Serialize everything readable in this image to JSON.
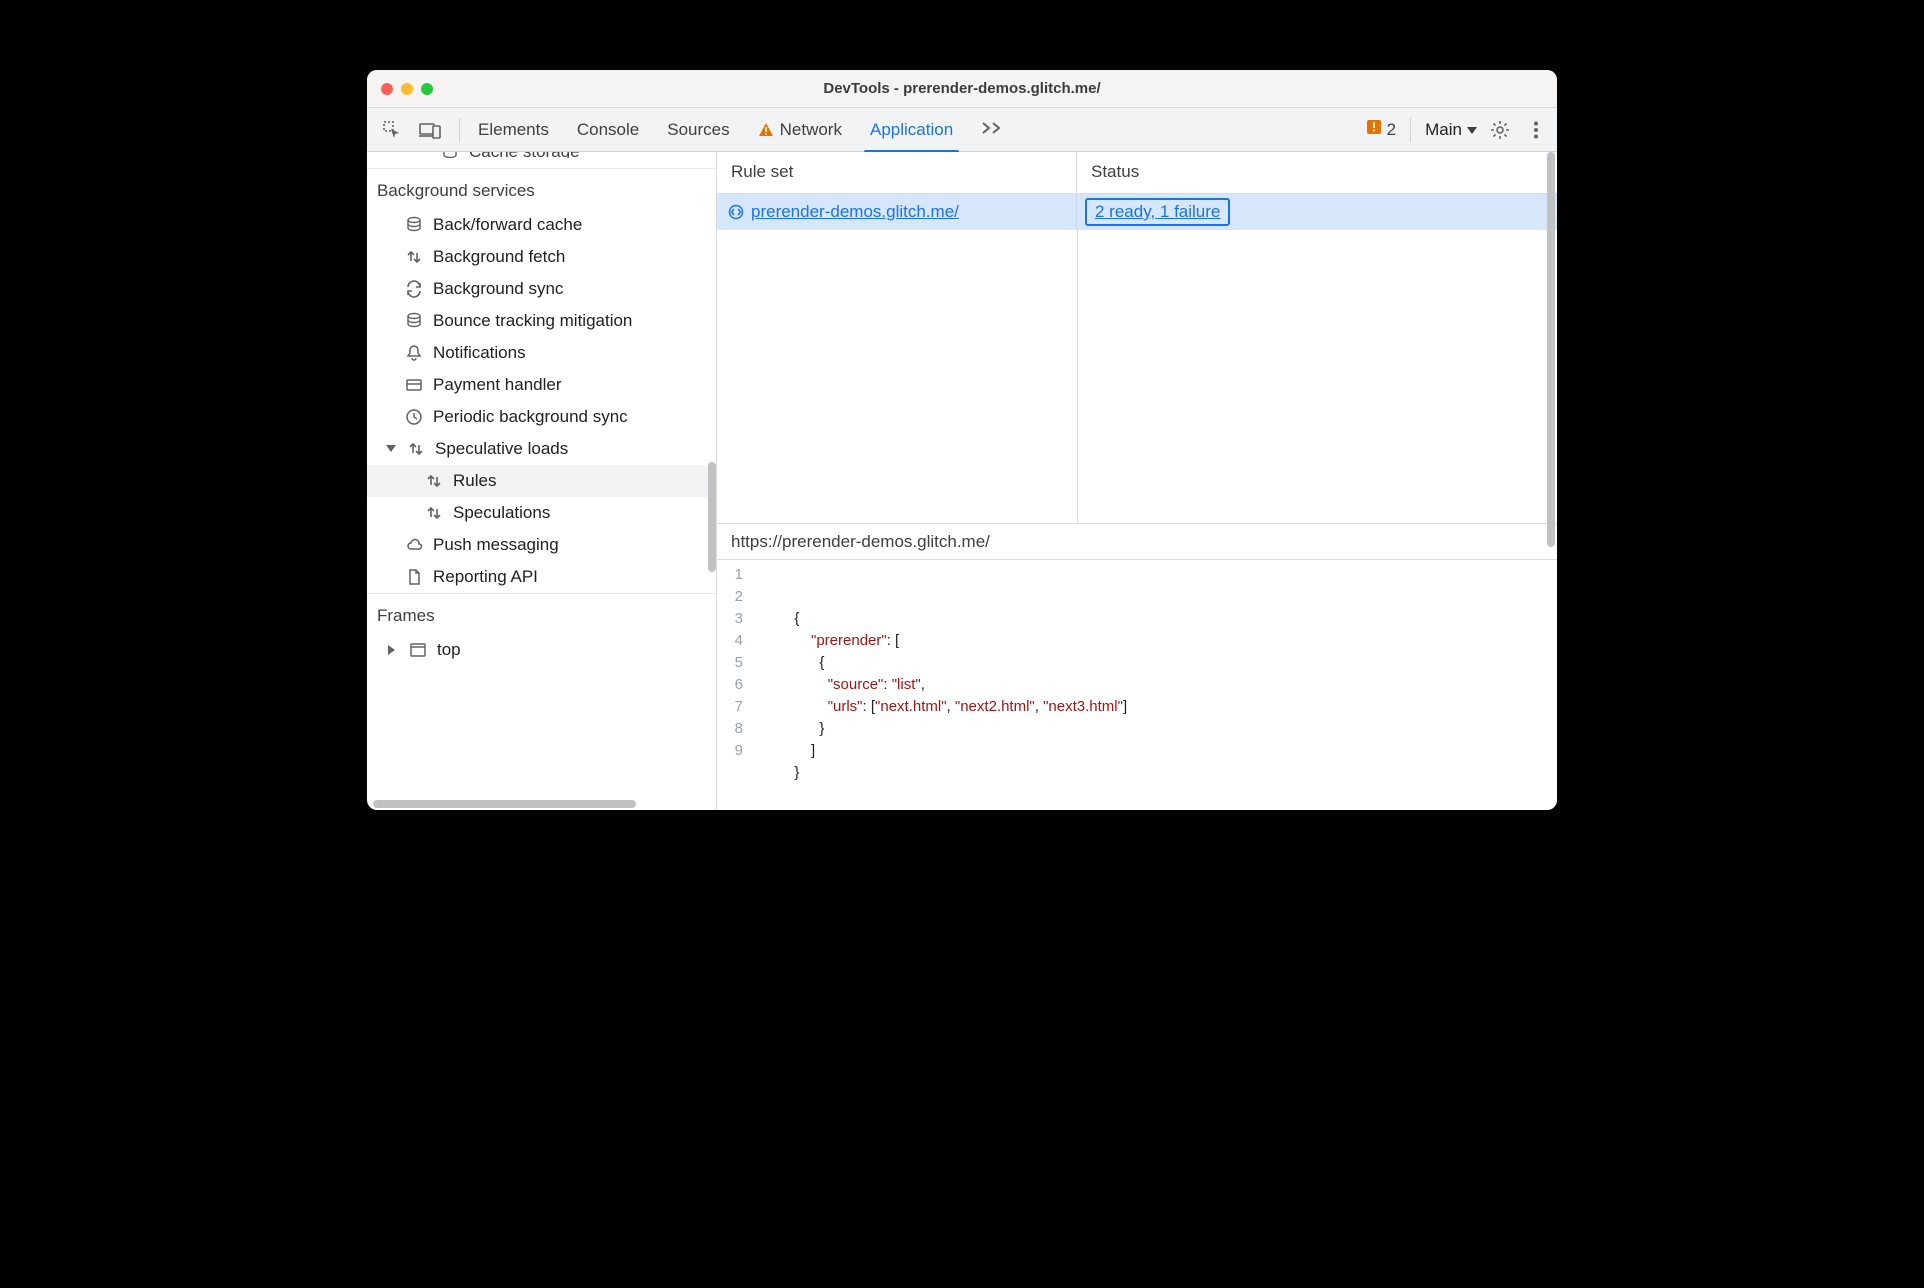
{
  "titlebar": {
    "title": "DevTools - prerender-demos.glitch.me/"
  },
  "tabs": {
    "elements": "Elements",
    "console": "Console",
    "sources": "Sources",
    "network": "Network",
    "application": "Application"
  },
  "toolbar": {
    "issues_count": "2",
    "context_label": "Main"
  },
  "sidebar": {
    "truncated_top": "Cache storage",
    "bg_services_header": "Background services",
    "items": [
      {
        "name": "back-forward-cache",
        "label": "Back/forward cache",
        "icon": "db"
      },
      {
        "name": "background-fetch",
        "label": "Background fetch",
        "icon": "updown"
      },
      {
        "name": "background-sync",
        "label": "Background sync",
        "icon": "sync"
      },
      {
        "name": "bounce-tracking",
        "label": "Bounce tracking mitigation",
        "icon": "db"
      },
      {
        "name": "notifications",
        "label": "Notifications",
        "icon": "bell"
      },
      {
        "name": "payment-handler",
        "label": "Payment handler",
        "icon": "card"
      },
      {
        "name": "periodic-bg-sync",
        "label": "Periodic background sync",
        "icon": "clock"
      },
      {
        "name": "speculative-loads",
        "label": "Speculative loads",
        "icon": "updown",
        "expandable": true,
        "expanded": true,
        "children": [
          {
            "name": "rules",
            "label": "Rules",
            "icon": "updown",
            "selected": true
          },
          {
            "name": "speculations",
            "label": "Speculations",
            "icon": "updown"
          }
        ]
      },
      {
        "name": "push-messaging",
        "label": "Push messaging",
        "icon": "cloud"
      },
      {
        "name": "reporting-api",
        "label": "Reporting API",
        "icon": "doc"
      }
    ],
    "frames_header": "Frames",
    "frames_top": "top"
  },
  "table": {
    "head_ruleset": "Rule set",
    "head_status": "Status",
    "row": {
      "ruleset_label": " prerender-demos.glitch.me/",
      "status_label": "2 ready, 1 failure"
    }
  },
  "code_panel": {
    "header": "https://prerender-demos.glitch.me/",
    "lines": [
      "1",
      "2",
      "3",
      "4",
      "5",
      "6",
      "7",
      "8",
      "9"
    ],
    "json": {
      "key_prerender": "\"prerender\"",
      "key_source": "\"source\"",
      "key_urls": "\"urls\"",
      "val_list": "\"list\"",
      "val_u1": "\"next.html\"",
      "val_u2": "\"next2.html\"",
      "val_u3": "\"next3.html\""
    }
  }
}
